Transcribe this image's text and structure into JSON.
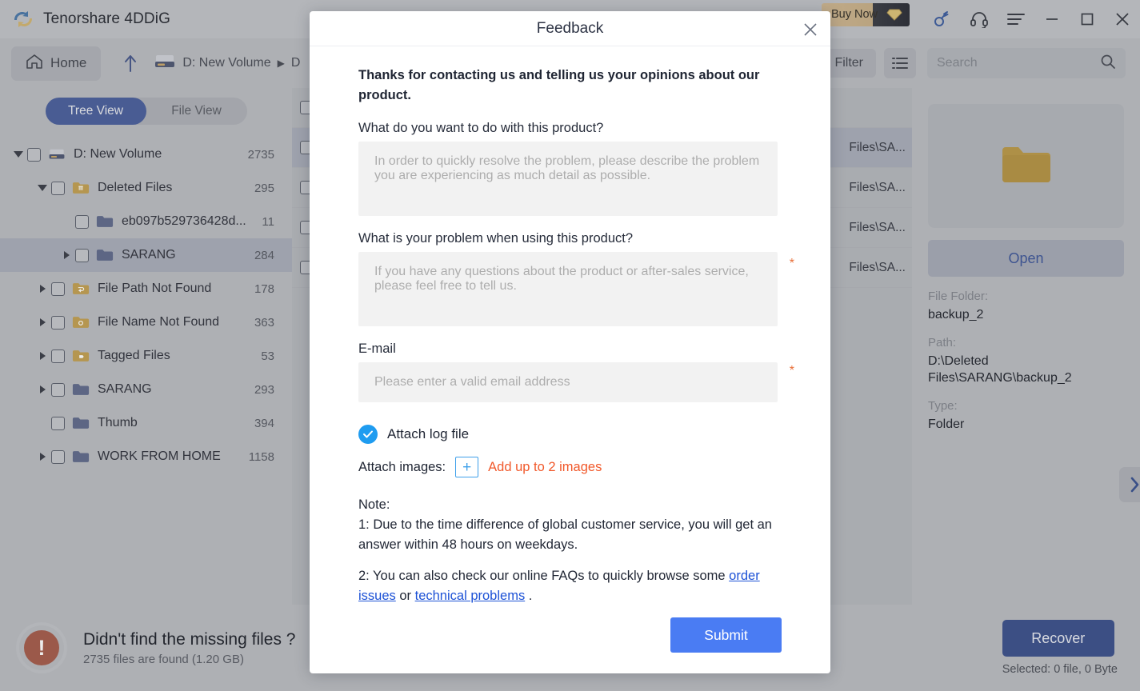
{
  "app": {
    "title": "Tenorshare 4DDiG",
    "logo_icon": "4ddig-logo-icon"
  },
  "titlebar": {
    "buy_now": "Buy Now",
    "gem_icon": "diamond-icon",
    "key_icon": "key-icon",
    "headset_icon": "headset-icon",
    "menu_icon": "hamburger-menu-icon",
    "minimize_icon": "minimize-icon",
    "maximize_icon": "maximize-icon",
    "close_icon": "close-icon"
  },
  "toolbar": {
    "home_label": "Home",
    "home_icon": "home-icon",
    "up_icon": "arrow-up-icon",
    "drive_icon": "hard-drive-icon",
    "breadcrumb": [
      "D: New Volume",
      "D"
    ],
    "filter_label": "Filter",
    "list_view_icon": "list-view-icon",
    "search_placeholder": "Search",
    "search_value": "",
    "search_icon": "search-icon"
  },
  "sidebar": {
    "tabs": [
      {
        "label": "Tree View",
        "active": true
      },
      {
        "label": "File View",
        "active": false
      }
    ],
    "tree": [
      {
        "label": "D: New Volume",
        "count": "2735",
        "indent": 0,
        "twisty": "down",
        "icon": "hard-drive-icon",
        "selected": false
      },
      {
        "label": "Deleted Files",
        "count": "295",
        "indent": 1,
        "twisty": "down",
        "icon": "folder-trash-icon",
        "selected": false
      },
      {
        "label": "eb097b529736428d...",
        "count": "11",
        "indent": 2,
        "twisty": "none",
        "icon": "folder-blue-icon",
        "selected": false
      },
      {
        "label": "SARANG",
        "count": "284",
        "indent": 2,
        "twisty": "right",
        "icon": "folder-blue-icon",
        "selected": true
      },
      {
        "label": "File Path Not Found",
        "count": "178",
        "indent": 1,
        "twisty": "right",
        "icon": "folder-path-icon",
        "selected": false
      },
      {
        "label": "File Name Not Found",
        "count": "363",
        "indent": 1,
        "twisty": "right",
        "icon": "folder-name-icon",
        "selected": false
      },
      {
        "label": "Tagged Files",
        "count": "53",
        "indent": 1,
        "twisty": "right",
        "icon": "folder-tag-icon",
        "selected": false
      },
      {
        "label": "SARANG",
        "count": "293",
        "indent": 1,
        "twisty": "right",
        "icon": "folder-blue-icon",
        "selected": false
      },
      {
        "label": "Thumb",
        "count": "394",
        "indent": 1,
        "twisty": "none",
        "icon": "folder-blue-icon",
        "selected": false
      },
      {
        "label": "WORK FROM HOME",
        "count": "1158",
        "indent": 1,
        "twisty": "right",
        "icon": "folder-blue-icon",
        "selected": false
      }
    ]
  },
  "filelist": {
    "rows": [
      {
        "path": "",
        "selected": false
      },
      {
        "path": "Files\\SA...",
        "selected": true
      },
      {
        "path": "Files\\SA...",
        "selected": false
      },
      {
        "path": "Files\\SA...",
        "selected": false
      },
      {
        "path": "Files\\SA...",
        "selected": false
      }
    ]
  },
  "details": {
    "preview_icon": "folder-large-icon",
    "open_label": "Open",
    "fields": [
      {
        "key": "File Folder:",
        "value": "backup_2"
      },
      {
        "key": "Path:",
        "value": "D:\\Deleted Files\\SARANG\\backup_2"
      },
      {
        "key": "Type:",
        "value": "Folder"
      }
    ],
    "expand_icon": "chevron-right-icon"
  },
  "bottombar": {
    "warn_icon": "exclamation-icon",
    "title": "Didn't find the missing files ?",
    "subtitle": "2735 files are found (1.20 GB)",
    "recover_label": "Recover",
    "selected_text": "Selected: 0 file, 0 Byte"
  },
  "dialog": {
    "title": "Feedback",
    "close_icon": "close-icon",
    "intro": "Thanks for contacting us and telling us your opinions about our product.",
    "q1_label": "What do you want to do with this product?",
    "q1_placeholder": "In order to quickly resolve the problem, please describe the problem you are experiencing as much detail as possible.",
    "q1_value": "",
    "q2_label": "What is your problem when using this product?",
    "q2_placeholder": "If you have any questions about the product or after-sales service, please feel free to tell us.",
    "q2_value": "",
    "q2_required_mark": "*",
    "email_label": "E-mail",
    "email_placeholder": "Please enter a valid email address",
    "email_value": "",
    "email_required_mark": "*",
    "attach_log_label": "Attach log file",
    "attach_log_checked": true,
    "check_icon": "check-icon",
    "attach_images_label": "Attach images:",
    "plus_icon": "plus-icon",
    "add_images_hint": "Add up to 2 images",
    "note_heading": "Note:",
    "note_1": "1: Due to the time difference of global customer service, you will get an answer within 48 hours on weekdays.",
    "note_2_before": "2: You can also check our online FAQs to quickly browse some ",
    "note_2_link1": "order issues",
    "note_2_mid": " or ",
    "note_2_link2": "technical problems",
    "note_2_after": " .",
    "submit_label": "Submit"
  },
  "colors": {
    "accent_blue": "#3e63ce",
    "submit_blue": "#4a7cf3",
    "link_blue": "#1d52d6",
    "orange": "#f1582a",
    "required_red": "#e8703a",
    "checkbox_blue": "#1f9cf0",
    "warn_red": "#d65437",
    "window_bg": "#b9bdc5"
  }
}
